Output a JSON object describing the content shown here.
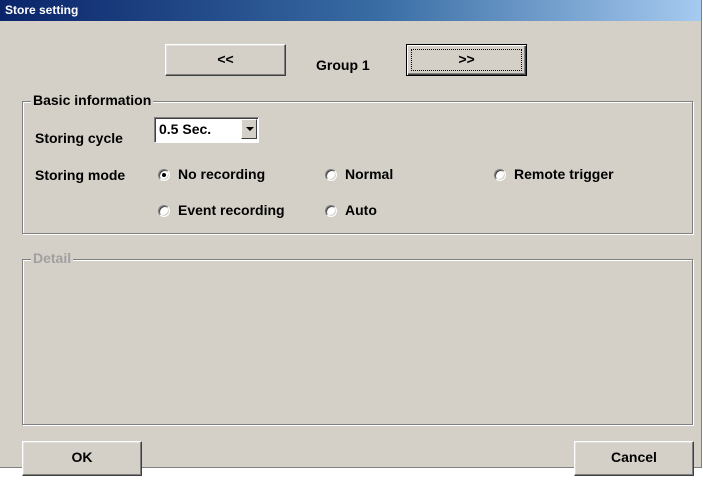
{
  "window": {
    "title": "Store setting"
  },
  "nav": {
    "prev_label": "<<",
    "next_label": ">>",
    "group_label": "Group 1"
  },
  "basic": {
    "legend": "Basic information",
    "storing_cycle_label": "Storing cycle",
    "storing_cycle_value": "0.5 Sec.",
    "storing_mode_label": "Storing mode",
    "modes": [
      {
        "label": "No recording",
        "selected": true
      },
      {
        "label": "Normal",
        "selected": false
      },
      {
        "label": "Remote trigger",
        "selected": false
      },
      {
        "label": "Event recording",
        "selected": false
      },
      {
        "label": "Auto",
        "selected": false
      }
    ]
  },
  "detail": {
    "legend": "Detail"
  },
  "footer": {
    "ok_label": "OK",
    "cancel_label": "Cancel"
  },
  "colors": {
    "face": "#d4d0c8",
    "title_start": "#0a246a",
    "title_end": "#a6caf0",
    "disabled_text": "#a0a0a0"
  }
}
